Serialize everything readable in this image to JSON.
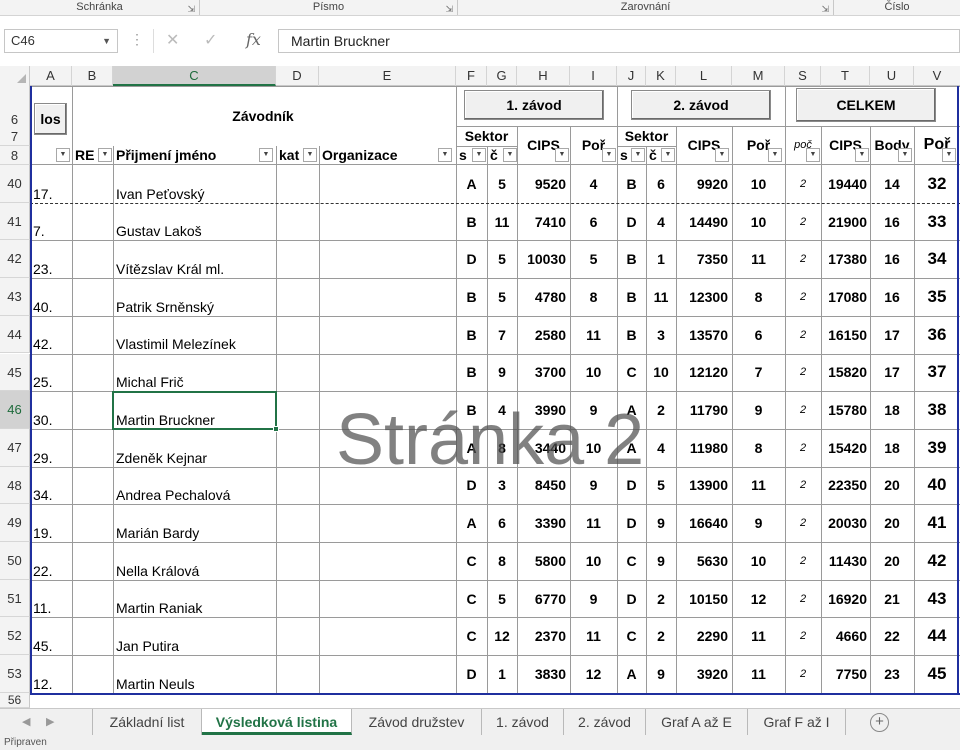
{
  "ribbon": {
    "groups": [
      "Schránka",
      "Písmo",
      "Zarovnání",
      "Číslo"
    ]
  },
  "formula_bar": {
    "name_box": "C46",
    "fx_label": "fx",
    "value": "Martin Bruckner"
  },
  "columns": [
    "A",
    "B",
    "C",
    "D",
    "E",
    "F",
    "G",
    "H",
    "I",
    "J",
    "K",
    "L",
    "M",
    "S",
    "T",
    "U",
    "V"
  ],
  "selected_column": "C",
  "header": {
    "zavodnik": "Závodník",
    "los_button": "los",
    "btn_zavod1": "1. závod",
    "btn_zavod2": "2. závod",
    "btn_celkem": "CELKEM",
    "sektor1": "Sektor",
    "cips1": "CIPS",
    "por1": "Poř",
    "sektor2": "Sektor",
    "cips2": "CIPS",
    "por2": "Poř",
    "poc": "poč",
    "cips3": "CIPS",
    "body": "Body",
    "por3": "Poř",
    "filters": {
      "a": "",
      "re": "RE",
      "prijmeni": "Přijmení jméno",
      "kat": "kat",
      "organizace": "Organizace",
      "s1": "s",
      "c1": "č",
      "s2": "s",
      "c2": "č"
    },
    "row_labels": [
      "6",
      "7",
      "8"
    ]
  },
  "rows": [
    {
      "row": "40",
      "a": "17.",
      "name": "Ivan Peťovský",
      "s1": "A",
      "c1": "5",
      "cips1": "9520",
      "por1": "4",
      "s2": "B",
      "c2": "6",
      "cips2": "9920",
      "por2": "10",
      "poc": "2",
      "cips": "19440",
      "body": "14",
      "por": "32"
    },
    {
      "row": "41",
      "a": "7.",
      "name": "Gustav Lakoš",
      "s1": "B",
      "c1": "11",
      "cips1": "7410",
      "por1": "6",
      "s2": "D",
      "c2": "4",
      "cips2": "14490",
      "por2": "10",
      "poc": "2",
      "cips": "21900",
      "body": "16",
      "por": "33"
    },
    {
      "row": "42",
      "a": "23.",
      "name": "Vítězslav Král ml.",
      "s1": "D",
      "c1": "5",
      "cips1": "10030",
      "por1": "5",
      "s2": "B",
      "c2": "1",
      "cips2": "7350",
      "por2": "11",
      "poc": "2",
      "cips": "17380",
      "body": "16",
      "por": "34"
    },
    {
      "row": "43",
      "a": "40.",
      "name": "Patrik Srněnský",
      "s1": "B",
      "c1": "5",
      "cips1": "4780",
      "por1": "8",
      "s2": "B",
      "c2": "11",
      "cips2": "12300",
      "por2": "8",
      "poc": "2",
      "cips": "17080",
      "body": "16",
      "por": "35"
    },
    {
      "row": "44",
      "a": "42.",
      "name": "Vlastimil Melezínek",
      "s1": "B",
      "c1": "7",
      "cips1": "2580",
      "por1": "11",
      "s2": "B",
      "c2": "3",
      "cips2": "13570",
      "por2": "6",
      "poc": "2",
      "cips": "16150",
      "body": "17",
      "por": "36"
    },
    {
      "row": "45",
      "a": "25.",
      "name": "Michal Frič",
      "s1": "B",
      "c1": "9",
      "cips1": "3700",
      "por1": "10",
      "s2": "C",
      "c2": "10",
      "cips2": "12120",
      "por2": "7",
      "poc": "2",
      "cips": "15820",
      "body": "17",
      "por": "37"
    },
    {
      "row": "46",
      "a": "30.",
      "name": "Martin Bruckner",
      "s1": "B",
      "c1": "4",
      "cips1": "3990",
      "por1": "9",
      "s2": "A",
      "c2": "2",
      "cips2": "11790",
      "por2": "9",
      "poc": "2",
      "cips": "15780",
      "body": "18",
      "por": "38"
    },
    {
      "row": "47",
      "a": "29.",
      "name": "Zdeněk Kejnar",
      "s1": "A",
      "c1": "8",
      "cips1": "3440",
      "por1": "10",
      "s2": "A",
      "c2": "4",
      "cips2": "11980",
      "por2": "8",
      "poc": "2",
      "cips": "15420",
      "body": "18",
      "por": "39"
    },
    {
      "row": "48",
      "a": "34.",
      "name": "Andrea Pechalová",
      "s1": "D",
      "c1": "3",
      "cips1": "8450",
      "por1": "9",
      "s2": "D",
      "c2": "5",
      "cips2": "13900",
      "por2": "11",
      "poc": "2",
      "cips": "22350",
      "body": "20",
      "por": "40"
    },
    {
      "row": "49",
      "a": "19.",
      "name": "Marián Bardy",
      "s1": "A",
      "c1": "6",
      "cips1": "3390",
      "por1": "11",
      "s2": "D",
      "c2": "9",
      "cips2": "16640",
      "por2": "9",
      "poc": "2",
      "cips": "20030",
      "body": "20",
      "por": "41"
    },
    {
      "row": "50",
      "a": "22.",
      "name": "Nella Králová",
      "s1": "C",
      "c1": "8",
      "cips1": "5800",
      "por1": "10",
      "s2": "C",
      "c2": "9",
      "cips2": "5630",
      "por2": "10",
      "poc": "2",
      "cips": "11430",
      "body": "20",
      "por": "42"
    },
    {
      "row": "51",
      "a": "11.",
      "name": "Martin Raniak",
      "s1": "C",
      "c1": "5",
      "cips1": "6770",
      "por1": "9",
      "s2": "D",
      "c2": "2",
      "cips2": "10150",
      "por2": "12",
      "poc": "2",
      "cips": "16920",
      "body": "21",
      "por": "43"
    },
    {
      "row": "52",
      "a": "45.",
      "name": "Jan Putira",
      "s1": "C",
      "c1": "12",
      "cips1": "2370",
      "por1": "11",
      "s2": "C",
      "c2": "2",
      "cips2": "2290",
      "por2": "11",
      "poc": "2",
      "cips": "4660",
      "body": "22",
      "por": "44"
    },
    {
      "row": "53",
      "a": "12.",
      "name": "Martin Neuls",
      "s1": "D",
      "c1": "1",
      "cips1": "3830",
      "por1": "12",
      "s2": "A",
      "c2": "9",
      "cips2": "3920",
      "por2": "11",
      "poc": "2",
      "cips": "7750",
      "body": "23",
      "por": "45"
    }
  ],
  "selected_row": "46",
  "last_row_label": "56",
  "page_watermark": "Stránka 2",
  "sheet_tabs": [
    "Základní list",
    "Výsledková listina",
    "Závod družstev",
    "1. závod",
    "2. závod",
    "Graf A až E",
    "Graf F až I"
  ],
  "active_tab": "Výsledková listina",
  "status": "Připraven",
  "colors": {
    "accent": "#217346",
    "page_border": "#1f2f9e"
  }
}
